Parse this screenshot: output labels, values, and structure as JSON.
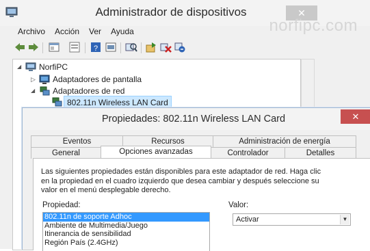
{
  "watermark": "norfipc.com",
  "device_manager": {
    "title": "Administrador de dispositivos",
    "menu": [
      "Archivo",
      "Acción",
      "Ver",
      "Ayuda"
    ],
    "toolbar_icons": [
      "back-arrow-icon",
      "forward-arrow-icon",
      "properties-icon",
      "show-hidden-icon",
      "help-icon",
      "scan-icon",
      "update-driver-icon",
      "disable-icon",
      "uninstall-icon"
    ],
    "tree": {
      "root": "NorfiPC",
      "items": [
        "Adaptadores de pantalla",
        "Adaptadores de red",
        "802.11n Wireless LAN Card"
      ]
    }
  },
  "properties_dialog": {
    "title": "Propiedades: 802.11n Wireless LAN Card",
    "close_label": "✕",
    "tabs_row1": [
      "Eventos",
      "Recursos",
      "Administración de energía"
    ],
    "tabs_row2": [
      "General",
      "Opciones avanzadas",
      "Controlador",
      "Detalles"
    ],
    "active_tab": "Opciones avanzadas",
    "description": "Las siguientes propiedades están disponibles para este adaptador de red. Haga clic en la propiedad en el cuadro izquierdo que desea cambiar y después seleccione su valor en el menú desplegable derecho.",
    "property_label": "Propiedad:",
    "value_label": "Valor:",
    "properties": [
      "802.11n de soporte Adhoc",
      "Ambiente de Multimedia/Juego",
      "Itinerancia de sensibilidad",
      "Región País (2.4GHz)"
    ],
    "selected_property": "802.11n de soporte Adhoc",
    "value": "Activar"
  }
}
